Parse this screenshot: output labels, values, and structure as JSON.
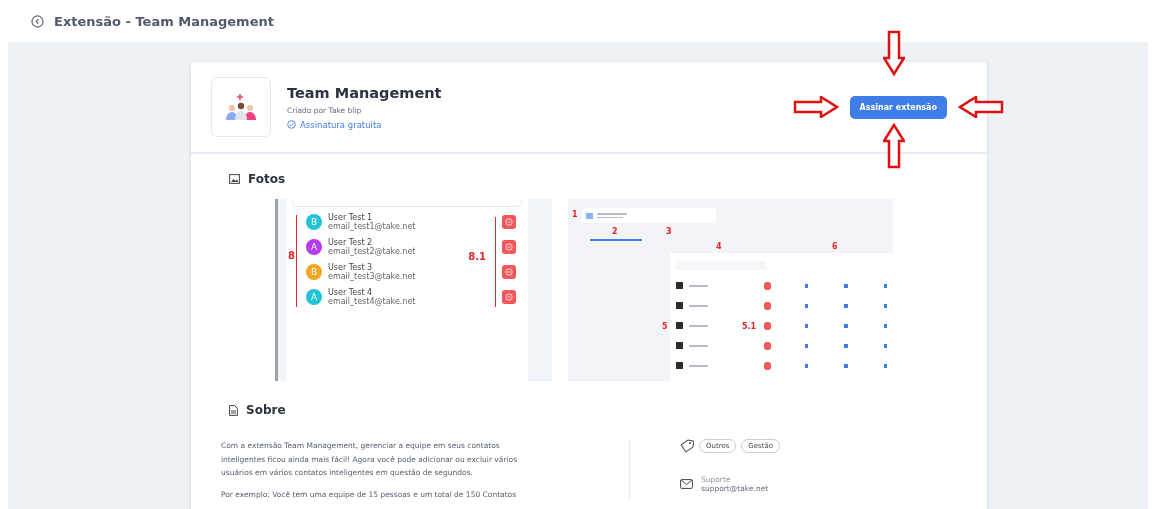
{
  "header": {
    "title": "Extensão - Team Management"
  },
  "extension": {
    "name": "Team Management",
    "author": "Criado por Take blip",
    "plan": "Assinatura gratuita",
    "action": "Assinar extensão"
  },
  "photos": {
    "title": "Fotos",
    "users_screenshot": {
      "bracket_labels": [
        "8",
        "8.1"
      ],
      "users": [
        {
          "initial": "B",
          "name": "User Test 1",
          "email": "email_test1@take.net",
          "color": "#22c3d6"
        },
        {
          "initial": "A",
          "name": "User Test 2",
          "email": "email_test2@take.net",
          "color": "#b43bf0"
        },
        {
          "initial": "B",
          "name": "User Test 3",
          "email": "email_test3@take.net",
          "color": "#f4a521"
        },
        {
          "initial": "A",
          "name": "User Test 4",
          "email": "email_test4@take.net",
          "color": "#22c3d6"
        }
      ]
    },
    "bots_screenshot": {
      "step_labels": [
        "1",
        "2",
        "3",
        "4",
        "5",
        "5.1",
        "6"
      ]
    }
  },
  "about": {
    "title": "Sobre",
    "paragraphs": [
      "Com a extensão Team Management, gerenciar a equipe em seus contatos inteligentes ficou ainda mais fácil! Agora você pode adicionar ou excluir vários usuários em vários contatos inteligentes em questão de segundos.",
      "Por exemplo: Você tem uma equipe de 15 pessoas e um total de 150 Contatos"
    ],
    "tags": [
      "Outros",
      "Gestão"
    ],
    "support_label": "Suporte",
    "support_email": "support@take.net"
  }
}
